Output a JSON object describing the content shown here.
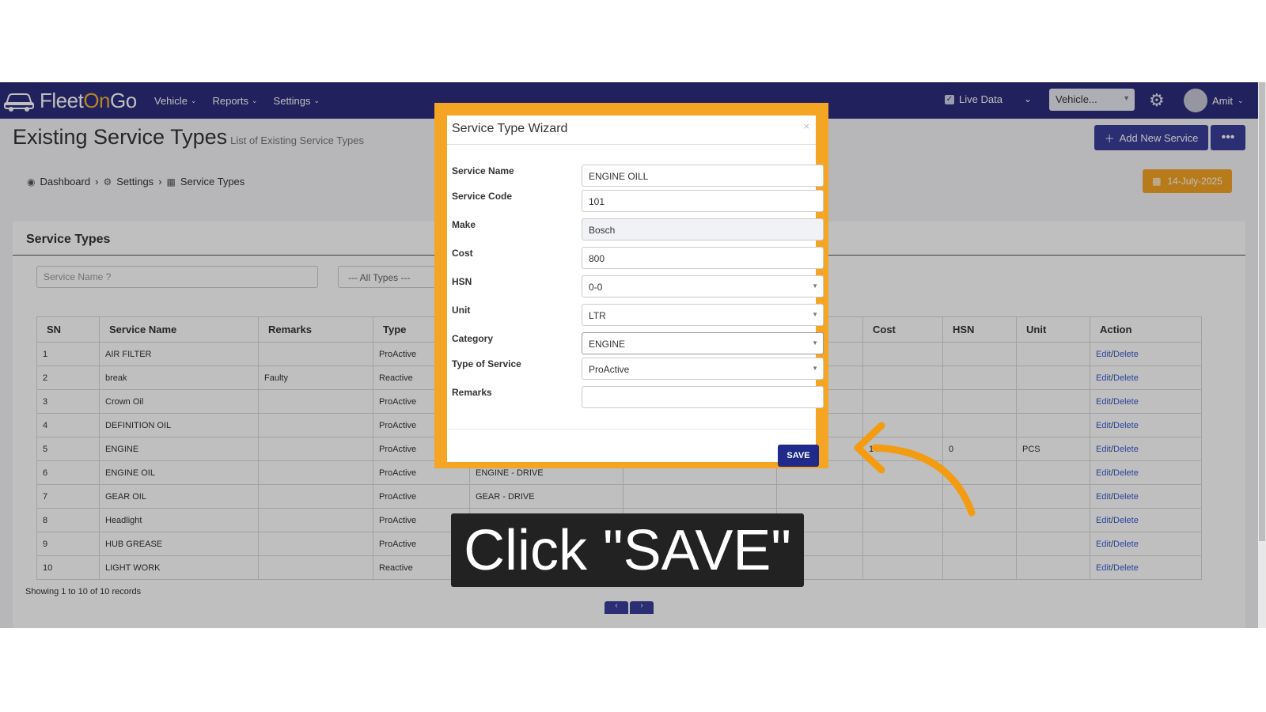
{
  "navbar": {
    "logo": {
      "fleet": "Fleet",
      "on": "On",
      "go": "Go"
    },
    "menu": [
      {
        "label": "Vehicle"
      },
      {
        "label": "Reports"
      },
      {
        "label": "Settings"
      }
    ],
    "live_data_label": "Live Data",
    "vehicle_select": "Vehicle...",
    "user_name": "Amit"
  },
  "header": {
    "title": "Existing Service Types",
    "subtitle": "List of Existing Service Types",
    "add_button": "Add New Service",
    "more_button": "•••"
  },
  "breadcrumb": [
    {
      "label": "Dashboard"
    },
    {
      "label": "Settings"
    },
    {
      "label": "Service Types"
    }
  ],
  "date_badge": "14-July-2025",
  "card": {
    "title": "Service Types",
    "search_placeholder": "Service Name ?",
    "types_filter": "--- All Types ---"
  },
  "table": {
    "columns": [
      "SN",
      "Service Name",
      "Remarks",
      "Type",
      "",
      "",
      "",
      "Cost",
      "HSN",
      "Unit",
      "Action"
    ],
    "rows": [
      {
        "sn": "1",
        "name": "AIR FILTER",
        "remarks": "",
        "type": "ProActive",
        "cat": "",
        "cost": "",
        "hsn": "",
        "unit": ""
      },
      {
        "sn": "2",
        "name": "break",
        "remarks": "Faulty",
        "type": "Reactive",
        "cat": "",
        "cost": "",
        "hsn": "",
        "unit": ""
      },
      {
        "sn": "3",
        "name": "Crown Oil",
        "remarks": "",
        "type": "ProActive",
        "cat": "",
        "cost": "",
        "hsn": "",
        "unit": ""
      },
      {
        "sn": "4",
        "name": "DEFINITION OIL",
        "remarks": "",
        "type": "ProActive",
        "cat": "",
        "cost": "",
        "hsn": "",
        "unit": ""
      },
      {
        "sn": "5",
        "name": "ENGINE",
        "remarks": "",
        "type": "ProActive",
        "cat": "",
        "cost": "1400",
        "hsn": "0",
        "unit": "PCS"
      },
      {
        "sn": "6",
        "name": "ENGINE OIL",
        "remarks": "",
        "type": "ProActive",
        "cat": "ENGINE - DRIVE",
        "cost": "",
        "hsn": "",
        "unit": ""
      },
      {
        "sn": "7",
        "name": "GEAR OIL",
        "remarks": "",
        "type": "ProActive",
        "cat": "GEAR - DRIVE",
        "cost": "",
        "hsn": "",
        "unit": ""
      },
      {
        "sn": "8",
        "name": "Headlight",
        "remarks": "",
        "type": "ProActive",
        "cat": "",
        "cost": "",
        "hsn": "",
        "unit": ""
      },
      {
        "sn": "9",
        "name": "HUB GREASE",
        "remarks": "",
        "type": "ProActive",
        "cat": "",
        "cost": "",
        "hsn": "",
        "unit": ""
      },
      {
        "sn": "10",
        "name": "LIGHT WORK",
        "remarks": "",
        "type": "Reactive",
        "cat": "",
        "cost": "",
        "hsn": "",
        "unit": ""
      }
    ],
    "edit_label": "Edit",
    "delete_label": "Delete",
    "separator": "/"
  },
  "showing_text": "Showing 1 to 10 of 10 records",
  "pager": {
    "prev": "‹",
    "next": "›"
  },
  "modal": {
    "title": "Service Type Wizard",
    "close": "×",
    "fields": {
      "service_name": {
        "label": "Service Name",
        "value": "ENGINE OILL"
      },
      "service_code": {
        "label": "Service Code",
        "value": "101"
      },
      "make": {
        "label": "Make",
        "value": "Bosch"
      },
      "cost": {
        "label": "Cost",
        "value": "800"
      },
      "hsn": {
        "label": "HSN",
        "value": "0-0"
      },
      "unit": {
        "label": "Unit",
        "value": "LTR"
      },
      "category": {
        "label": "Category",
        "value": "ENGINE"
      },
      "type_of_service": {
        "label": "Type of Service",
        "value": "ProActive"
      },
      "remarks": {
        "label": "Remarks",
        "value": ""
      }
    },
    "save_button": "SAVE"
  },
  "caption": "Click \"SAVE\"",
  "colors": {
    "navbar": "#2b2d7c",
    "accent_orange": "#f5a524",
    "save_button": "#1f2a8a",
    "caption_bg": "#222222"
  }
}
